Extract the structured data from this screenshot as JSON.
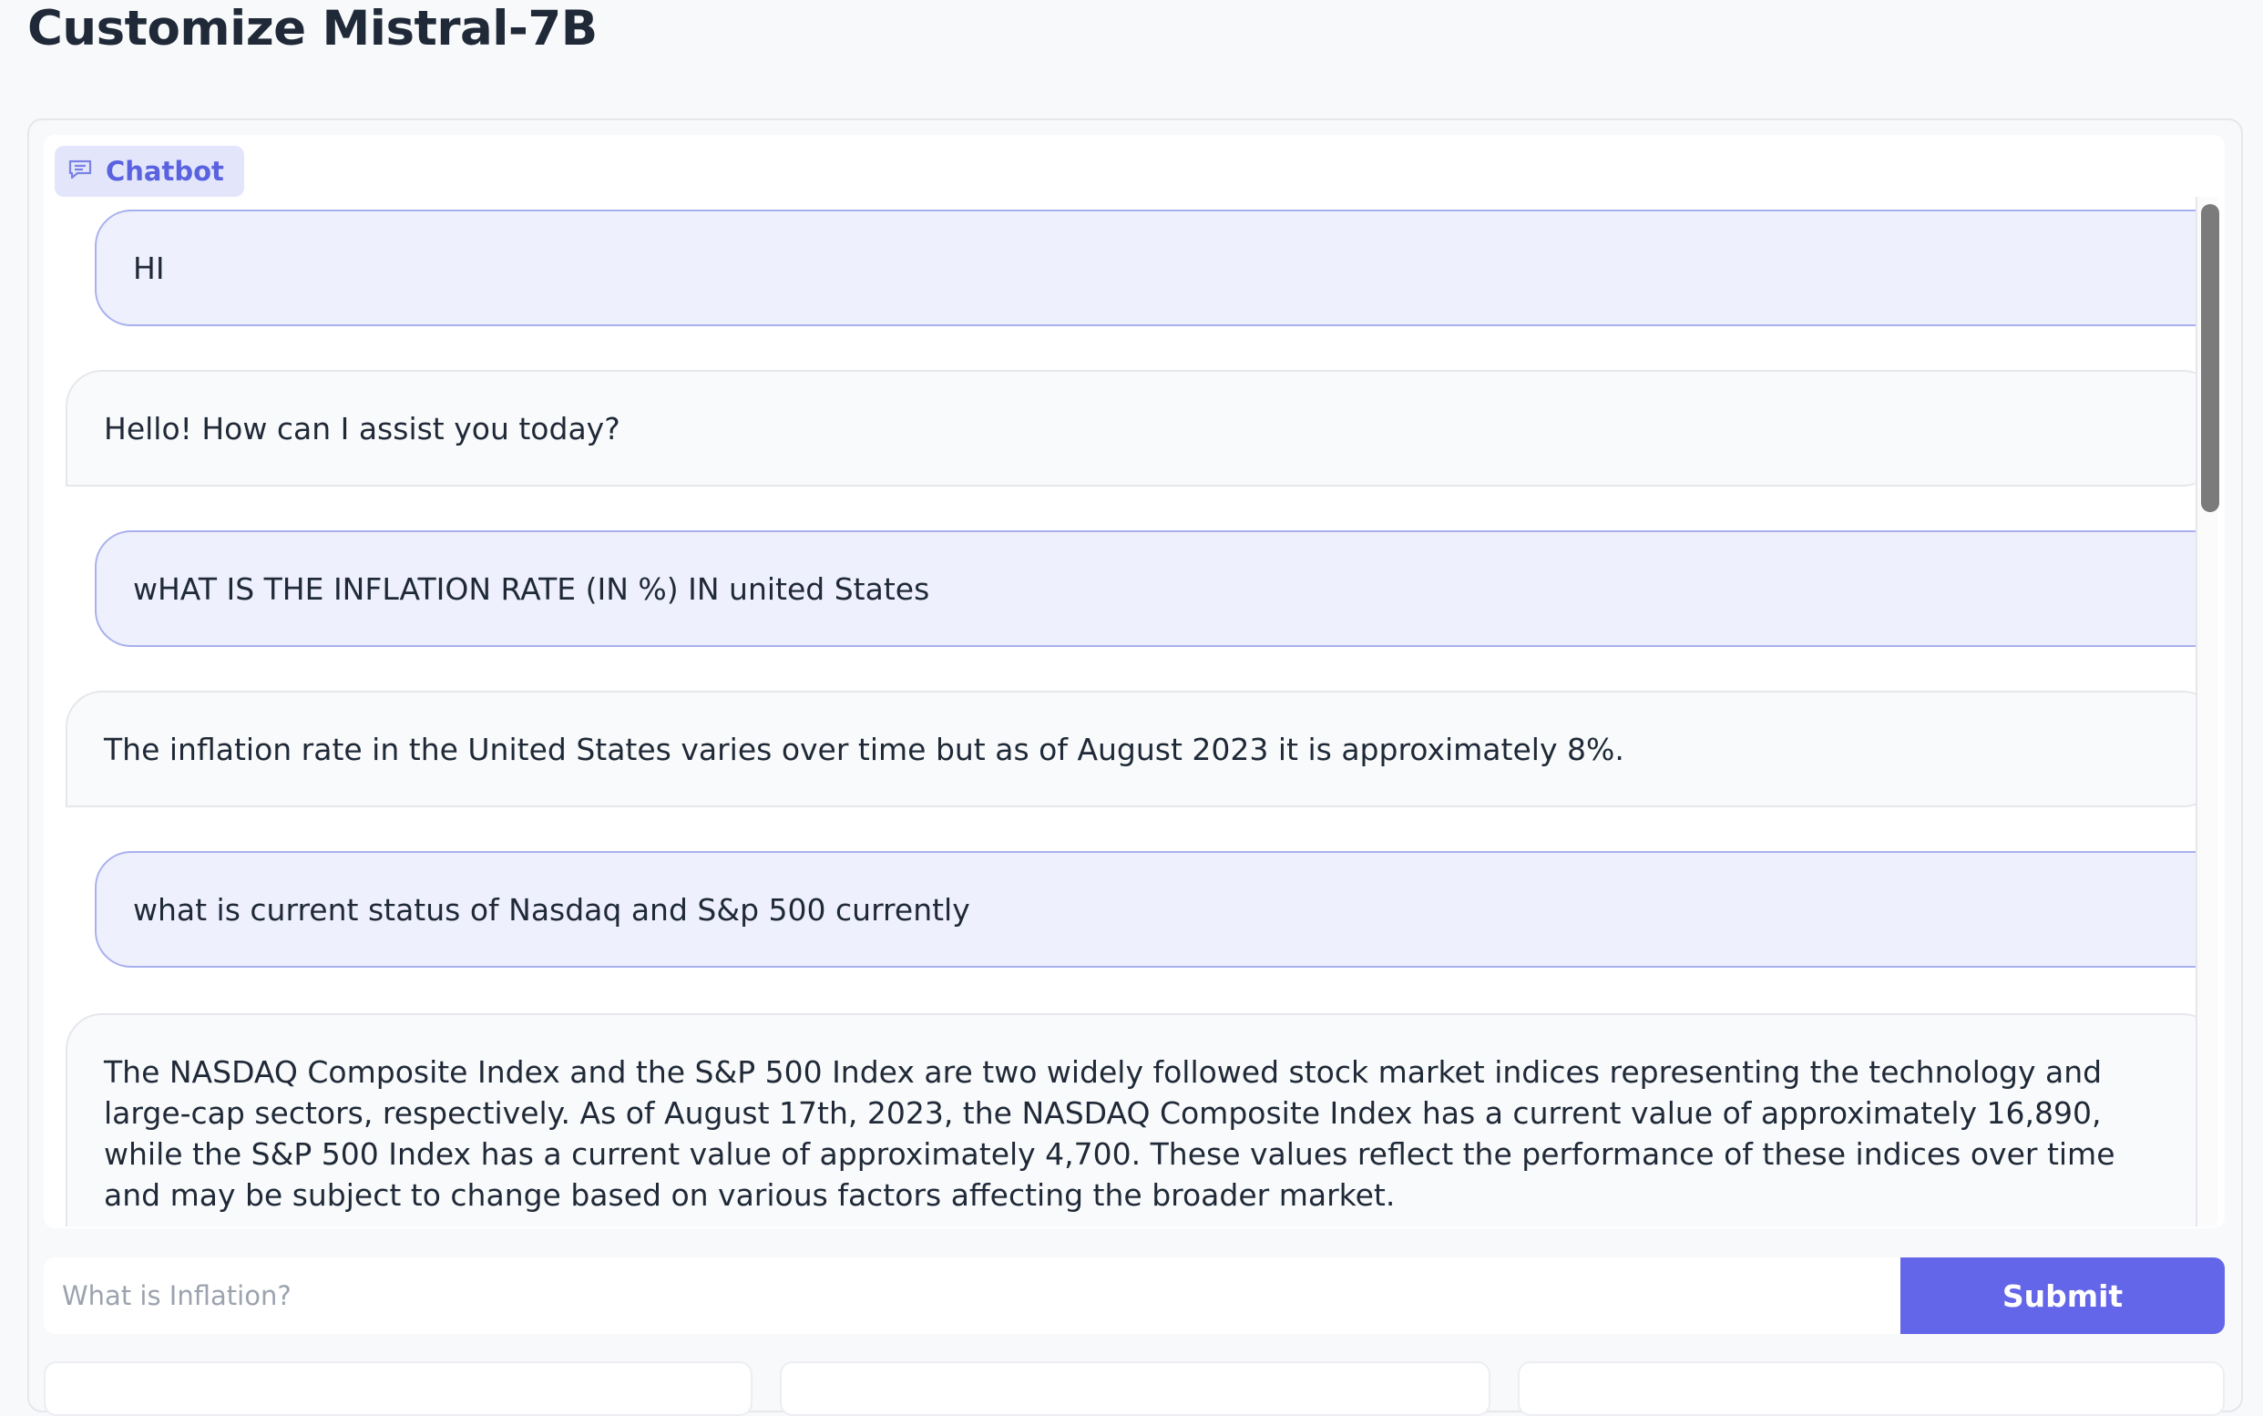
{
  "page": {
    "title": "Customize Mistral-7B"
  },
  "chatbot": {
    "label": "Chatbot",
    "icon": "chat-bubble-icon",
    "messages": [
      {
        "role": "user",
        "text": "HI"
      },
      {
        "role": "bot",
        "text": "Hello! How can I assist you today?"
      },
      {
        "role": "user",
        "text": "wHAT IS THE INFLATION RATE (IN %) IN united States"
      },
      {
        "role": "bot",
        "text": "The inflation rate in the United States varies over time but as of August 2023 it is approximately 8%."
      },
      {
        "role": "user",
        "text": "what is current status of Nasdaq and S&p 500 currently"
      },
      {
        "role": "bot",
        "text": "The NASDAQ Composite Index and the S&P 500 Index are two widely followed stock market indices representing the technology and large-cap sectors, respectively. As of August 17th, 2023, the NASDAQ Composite Index has a current value of approximately 16,890, while the S&P 500 Index has a current value of approximately 4,700. These values reflect the performance of these indices over time and may be subject to change based on various factors affecting the broader market."
      }
    ]
  },
  "input": {
    "placeholder": "What is Inflation?",
    "value": ""
  },
  "submit": {
    "label": "Submit"
  },
  "colors": {
    "accent": "#6366e8",
    "user_bubble": "#eef0fd",
    "bot_bubble": "#f9fafb"
  }
}
